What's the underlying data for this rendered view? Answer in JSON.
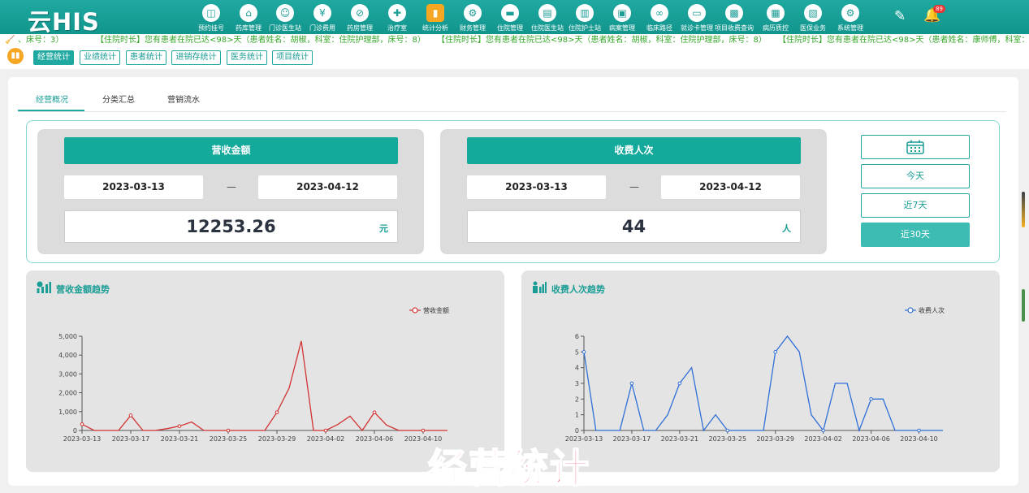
{
  "app": {
    "logo": "云HIS"
  },
  "nav": [
    {
      "label": "预约挂号",
      "icon": "calendar-icon"
    },
    {
      "label": "药库管理",
      "icon": "warehouse-icon"
    },
    {
      "label": "门诊医生站",
      "icon": "doctor-icon"
    },
    {
      "label": "门诊费用",
      "icon": "yen-icon"
    },
    {
      "label": "药房管理",
      "icon": "pill-icon"
    },
    {
      "label": "治疗室",
      "icon": "nurse-icon"
    },
    {
      "label": "统计分析",
      "icon": "chart-icon"
    },
    {
      "label": "财务管理",
      "icon": "gear-icon"
    },
    {
      "label": "住院管理",
      "icon": "bed-icon"
    },
    {
      "label": "住院医生站",
      "icon": "doctor-card-icon"
    },
    {
      "label": "住院护士站",
      "icon": "nurse-card-icon"
    },
    {
      "label": "病案管理",
      "icon": "folder-icon"
    },
    {
      "label": "临床路径",
      "icon": "path-icon"
    },
    {
      "label": "就诊卡管理",
      "icon": "card-icon"
    },
    {
      "label": "项目收费查询",
      "icon": "search-doc-icon"
    },
    {
      "label": "病历质控",
      "icon": "record-icon"
    },
    {
      "label": "医保业务",
      "icon": "id-card-icon"
    },
    {
      "label": "系统管理",
      "icon": "settings-icon"
    }
  ],
  "header": {
    "bell_count": "89"
  },
  "marquee": [
    "、床号：3）",
    "【住院时长】您有患者在院已达<98>天（患者姓名：胡椒，科室：住院护理部，床号：8）",
    "【住院时长】您有患者在院已达<98>天（患者姓名：胡椒，科室：住院护理部，床号：8）",
    "【住院时长】您有患者在院已达<98>天（患者姓名：康师傅，科室："
  ],
  "subnav": [
    "经营统计",
    "业绩统计",
    "患者统计",
    "进销存统计",
    "医务统计",
    "项目统计"
  ],
  "tabs": [
    "经营概况",
    "分类汇总",
    "营销流水"
  ],
  "revenue": {
    "title": "营收金额",
    "start": "2023-03-13",
    "sep": "—",
    "end": "2023-04-12",
    "value": "12253.26",
    "unit": "元"
  },
  "visits": {
    "title": "收费人次",
    "start": "2023-03-13",
    "sep": "—",
    "end": "2023-04-12",
    "value": "44",
    "unit": "人"
  },
  "range": {
    "today": "今天",
    "week": "近7天",
    "month": "近30天"
  },
  "charts": {
    "revenue_title": "营收金额趋势",
    "visits_title": "收费人次趋势"
  },
  "colors": {
    "accent": "#1fa9a0",
    "revenue_line": "#d23232",
    "visits_line": "#2f6fd6",
    "watermark": "#e8233a"
  },
  "watermark": "经营统计",
  "chart_data": [
    {
      "type": "line",
      "title": "营收金额趋势",
      "x": [
        "2023-03-13",
        "2023-03-14",
        "2023-03-15",
        "2023-03-16",
        "2023-03-17",
        "2023-03-18",
        "2023-03-19",
        "2023-03-20",
        "2023-03-21",
        "2023-03-22",
        "2023-03-23",
        "2023-03-24",
        "2023-03-25",
        "2023-03-26",
        "2023-03-27",
        "2023-03-28",
        "2023-03-29",
        "2023-03-30",
        "2023-03-31",
        "2023-04-01",
        "2023-04-02",
        "2023-04-03",
        "2023-04-04",
        "2023-04-05",
        "2023-04-06",
        "2023-04-07",
        "2023-04-08",
        "2023-04-09",
        "2023-04-10",
        "2023-04-11",
        "2023-04-12"
      ],
      "xticks": [
        "2023-03-13",
        "2023-03-17",
        "2023-03-21",
        "2023-03-25",
        "2023-03-29",
        "2023-04-02",
        "2023-04-06",
        "2023-04-10"
      ],
      "yticks": [
        "0",
        "1,000",
        "2,000",
        "3,000",
        "4,000",
        "5,000"
      ],
      "ylim": [
        0,
        5000
      ],
      "series": [
        {
          "name": "营收金额",
          "values": [
            330,
            0,
            0,
            0,
            800,
            0,
            0,
            100,
            230,
            450,
            0,
            0,
            0,
            0,
            0,
            0,
            960,
            2250,
            4750,
            0,
            0,
            320,
            760,
            0,
            960,
            280,
            0,
            0,
            0,
            0,
            0
          ]
        }
      ],
      "legend": "top-right"
    },
    {
      "type": "line",
      "title": "收费人次趋势",
      "x": [
        "2023-03-13",
        "2023-03-14",
        "2023-03-15",
        "2023-03-16",
        "2023-03-17",
        "2023-03-18",
        "2023-03-19",
        "2023-03-20",
        "2023-03-21",
        "2023-03-22",
        "2023-03-23",
        "2023-03-24",
        "2023-03-25",
        "2023-03-26",
        "2023-03-27",
        "2023-03-28",
        "2023-03-29",
        "2023-03-30",
        "2023-03-31",
        "2023-04-01",
        "2023-04-02",
        "2023-04-03",
        "2023-04-04",
        "2023-04-05",
        "2023-04-06",
        "2023-04-07",
        "2023-04-08",
        "2023-04-09",
        "2023-04-10",
        "2023-04-11",
        "2023-04-12"
      ],
      "xticks": [
        "2023-03-13",
        "2023-03-17",
        "2023-03-21",
        "2023-03-25",
        "2023-03-29",
        "2023-04-02",
        "2023-04-06",
        "2023-04-10"
      ],
      "yticks": [
        "0",
        "1",
        "2",
        "3",
        "4",
        "5",
        "6"
      ],
      "ylim": [
        0,
        6
      ],
      "series": [
        {
          "name": "收费人次",
          "values": [
            5,
            0,
            0,
            0,
            3,
            0,
            0,
            1,
            3,
            4,
            0,
            1,
            0,
            0,
            0,
            0,
            5,
            6,
            5,
            1,
            0,
            3,
            3,
            0,
            2,
            2,
            0,
            0,
            0,
            0,
            0
          ]
        }
      ],
      "legend": "top-right"
    }
  ]
}
